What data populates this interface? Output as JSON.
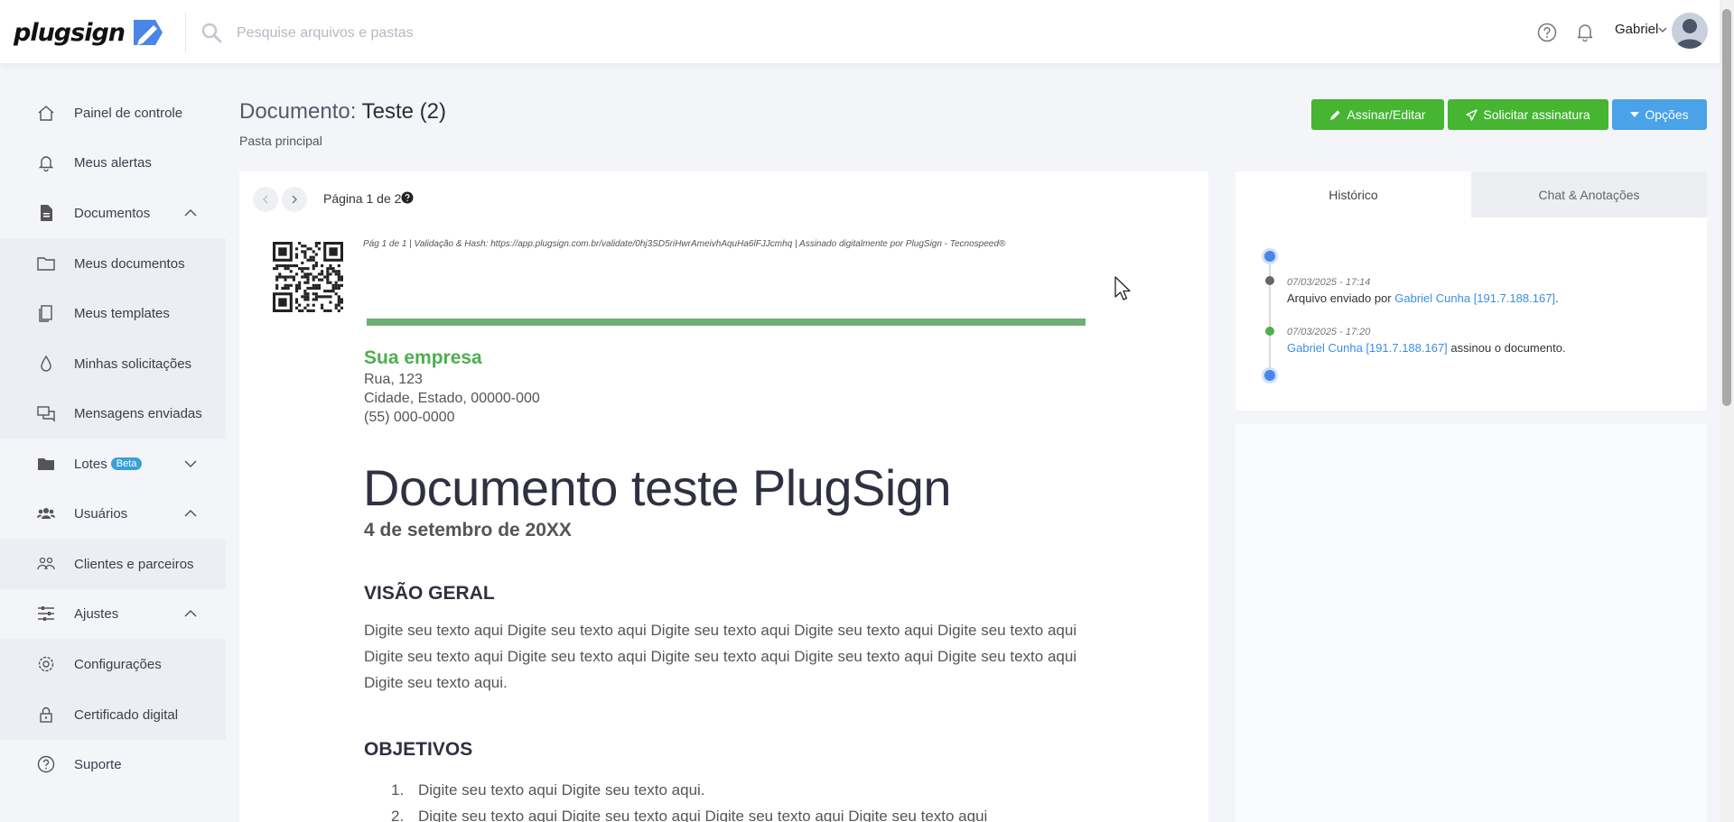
{
  "header": {
    "logo_text": "plugsign",
    "search_placeholder": "Pesquise arquivos e pastas",
    "user_name": "Gabriel"
  },
  "sidebar": {
    "items": [
      {
        "label": "Painel de controle",
        "icon": "home-icon"
      },
      {
        "label": "Meus alertas",
        "icon": "bell-icon"
      },
      {
        "label": "Documentos",
        "icon": "document-icon",
        "expanded": true
      },
      {
        "label": "Meus documentos",
        "icon": "folder-icon"
      },
      {
        "label": "Meus templates",
        "icon": "template-icon"
      },
      {
        "label": "Minhas solicitações",
        "icon": "drop-icon"
      },
      {
        "label": "Mensagens enviadas",
        "icon": "messages-icon"
      },
      {
        "label": "Lotes",
        "icon": "folder-filled-icon",
        "badge": "Beta",
        "expanded": false
      },
      {
        "label": "Usuários",
        "icon": "users-icon",
        "expanded": true
      },
      {
        "label": "Clientes e parceiros",
        "icon": "clients-icon"
      },
      {
        "label": "Ajustes",
        "icon": "sliders-icon",
        "expanded": true
      },
      {
        "label": "Configurações",
        "icon": "gear-icon"
      },
      {
        "label": "Certificado digital",
        "icon": "lock-icon"
      },
      {
        "label": "Suporte",
        "icon": "help-icon"
      }
    ]
  },
  "document": {
    "title_prefix": "Documento:",
    "title_name": "Teste (2)",
    "folder": "Pasta principal"
  },
  "actions": {
    "sign_label": "Assinar/Editar",
    "request_label": "Solicitar assinatura",
    "options_label": "Opções"
  },
  "viewer": {
    "page_info": "Página 1 de 2",
    "validation_text": "Pág 1 de 1 | Validação & Hash: https://app.plugsign.com.br/validate/0hj3SD5riHwrAmeivhAquHa6lFJJcmhq | Assinado digitalmente por PlugSign - Tecnospeed®",
    "company": "Sua empresa",
    "address": [
      "Rua, 123",
      "Cidade, Estado, 00000-000",
      "(55) 000-0000"
    ],
    "doc_heading": "Documento teste PlugSign",
    "date": "4 de setembro de 20XX",
    "section1": "VISÃO GERAL",
    "section1_text": "Digite seu texto aqui Digite seu texto aqui Digite seu texto aqui Digite seu texto aqui Digite seu texto aqui Digite seu texto aqui Digite seu texto aqui Digite seu texto aqui Digite seu texto aqui Digite seu texto aqui Digite seu texto aqui.",
    "section2": "OBJETIVOS",
    "objectives": [
      {
        "num": "1.",
        "text": "Digite seu texto aqui Digite seu texto aqui."
      },
      {
        "num": "2.",
        "text": "Digite seu texto aqui Digite seu texto aqui Digite seu texto aqui Digite seu texto aqui"
      }
    ]
  },
  "history": {
    "tab_history": "Histórico",
    "tab_chat": "Chat & Anotações",
    "events": [
      {
        "time": "07/03/2025 - 17:14",
        "text_before": "Arquivo enviado por ",
        "link": "Gabriel Cunha [191.7.188.167]",
        "text_after": ".",
        "dot_color": "#666666"
      },
      {
        "time": "07/03/2025 - 17:20",
        "text_before": "",
        "link": "Gabriel Cunha [191.7.188.167]",
        "text_after": " assinou o documento.",
        "dot_color": "#4caf50"
      }
    ]
  },
  "colors": {
    "green_button": "#45b532",
    "blue_button": "#4aa2e8",
    "brand_green": "#4caf50",
    "link_blue": "#3a8ee6"
  }
}
